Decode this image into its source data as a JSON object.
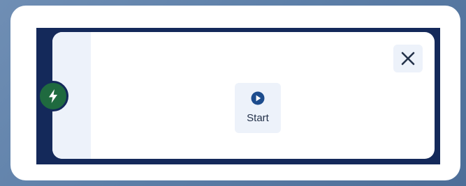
{
  "widget": {
    "start_label": "Start",
    "icons": {
      "badge": "lightning-bolt-icon",
      "close": "close-icon",
      "start": "play-circle-icon"
    },
    "colors": {
      "navy_frame": "#14295a",
      "badge_green": "#1f6a3f",
      "button_bg": "#edf2fa",
      "play_blue": "#1d4c8d",
      "close_icon": "#24324a"
    }
  }
}
